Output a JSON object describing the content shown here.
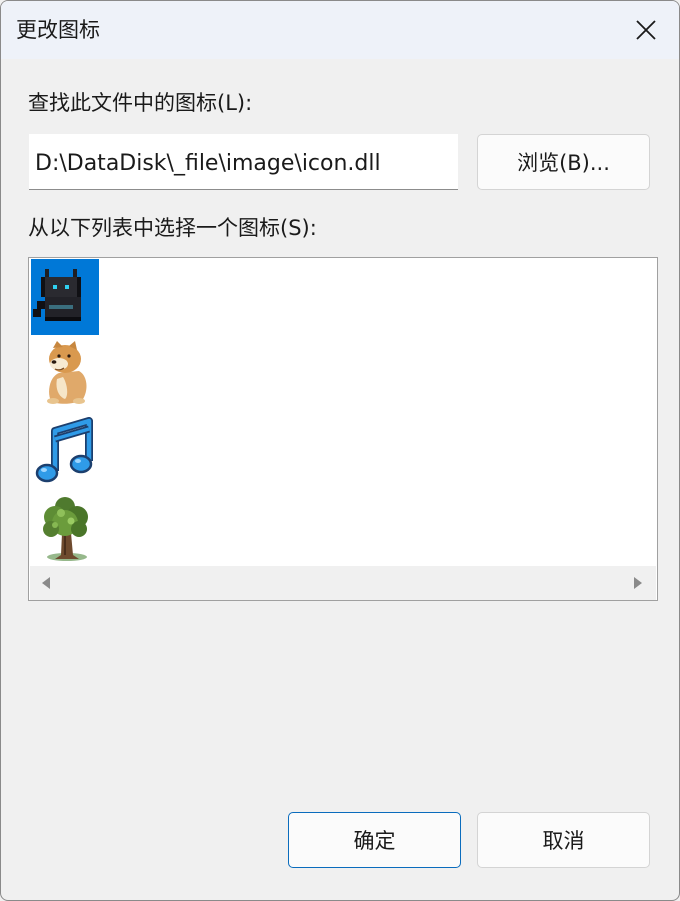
{
  "dialog": {
    "title": "更改图标",
    "close_icon": "close-icon"
  },
  "file_section": {
    "label": "查找此文件中的图标(L):",
    "path_value": "D:\\DataDisk\\_file\\image\\icon.dll",
    "browse_label": "浏览(B)..."
  },
  "list_section": {
    "label": "从以下列表中选择一个图标(S):",
    "icons": [
      {
        "name": "black-cat-icon",
        "selected": true
      },
      {
        "name": "cheems-dog-icon",
        "selected": false
      },
      {
        "name": "music-note-icon",
        "selected": false
      },
      {
        "name": "tree-icon",
        "selected": false
      }
    ],
    "scroll_left_icon": "scroll-left-arrow-icon",
    "scroll_right_icon": "scroll-right-arrow-icon"
  },
  "footer": {
    "ok_label": "确定",
    "cancel_label": "取消"
  },
  "colors": {
    "selection": "#0078d7",
    "background": "#f0f0f0",
    "titlebar": "#eef2f9",
    "primary_border": "#0a6cbd"
  }
}
